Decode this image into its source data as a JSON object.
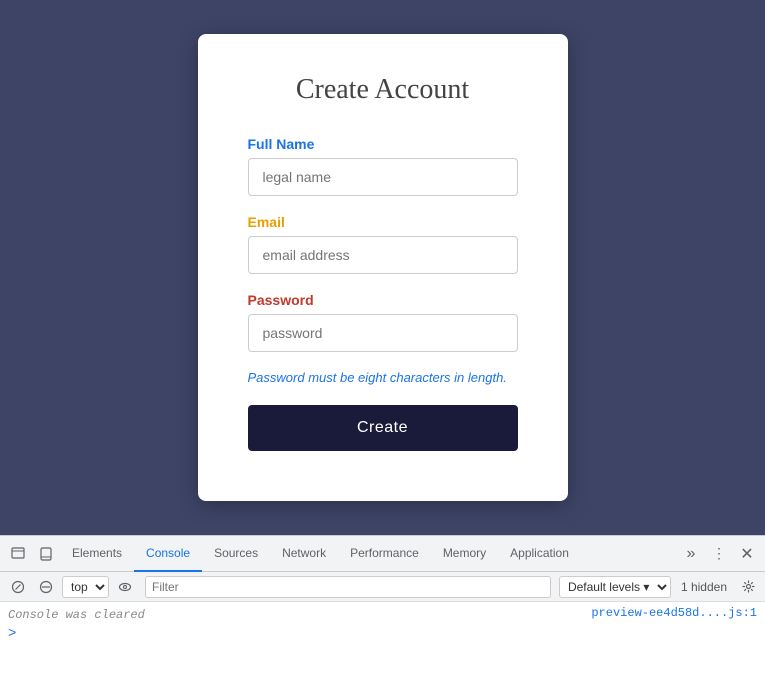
{
  "page": {
    "background_color": "#3d4466"
  },
  "card": {
    "title": "Create Account",
    "fullname_label": "Full Name",
    "fullname_placeholder": "legal name",
    "email_label": "Email",
    "email_placeholder": "email address",
    "password_label": "Password",
    "password_placeholder": "password",
    "password_hint": "Password must be eight characters in length.",
    "create_button_label": "Create"
  },
  "devtools": {
    "tabs": [
      {
        "label": "Elements",
        "active": false
      },
      {
        "label": "Console",
        "active": true
      },
      {
        "label": "Sources",
        "active": false
      },
      {
        "label": "Network",
        "active": false
      },
      {
        "label": "Performance",
        "active": false
      },
      {
        "label": "Memory",
        "active": false
      },
      {
        "label": "Application",
        "active": false
      }
    ],
    "console": {
      "top_select": "top",
      "filter_placeholder": "Filter",
      "default_levels": "Default levels ▾",
      "hidden_count": "1 hidden",
      "cleared_message": "Console was cleared",
      "link_text": "preview-ee4d58d....js:1"
    }
  }
}
